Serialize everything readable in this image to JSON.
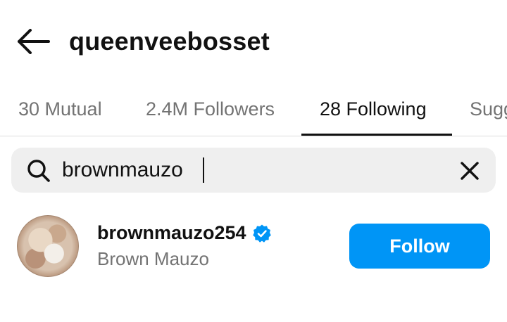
{
  "header": {
    "title": "queenveebosset",
    "back_icon": "arrow-left-icon"
  },
  "tabs": [
    {
      "label": "30 Mutual",
      "active": false
    },
    {
      "label": "2.4M Followers",
      "active": false
    },
    {
      "label": "28 Following",
      "active": true
    },
    {
      "label": "Suggested",
      "active": false
    }
  ],
  "search": {
    "value": "brownmauzo",
    "search_icon": "search-icon",
    "clear_icon": "close-icon"
  },
  "results": [
    {
      "username": "brownmauzo254",
      "full_name": "Brown Mauzo",
      "verified": true,
      "button_label": "Follow"
    }
  ],
  "colors": {
    "accent": "#0095f6",
    "text_primary": "#111111",
    "text_secondary": "#737373",
    "search_bg": "#efefef"
  }
}
